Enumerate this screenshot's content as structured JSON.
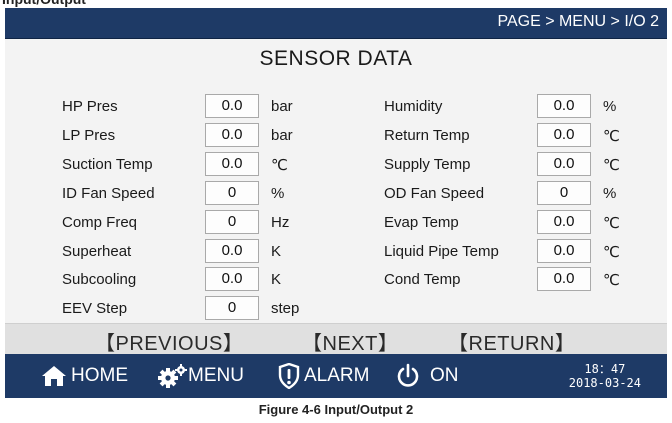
{
  "header": {
    "breadcrumb": "PAGE > MENU > I/O 2"
  },
  "title": "SENSOR DATA",
  "left_sensors": [
    {
      "label": "HP Pres",
      "value": "0.0",
      "unit": "bar"
    },
    {
      "label": "LP Pres",
      "value": "0.0",
      "unit": "bar"
    },
    {
      "label": "Suction Temp",
      "value": "0.0",
      "unit": "℃"
    },
    {
      "label": "ID Fan Speed",
      "value": "0",
      "unit": "%"
    },
    {
      "label": "Comp Freq",
      "value": "0",
      "unit": "Hz"
    },
    {
      "label": "Superheat",
      "value": "0.0",
      "unit": "K"
    },
    {
      "label": "Subcooling",
      "value": "0.0",
      "unit": "K"
    },
    {
      "label": "EEV Step",
      "value": "0",
      "unit": "step"
    }
  ],
  "right_sensors": [
    {
      "label": "Humidity",
      "value": "0.0",
      "unit": "%"
    },
    {
      "label": "Return Temp",
      "value": "0.0",
      "unit": "℃"
    },
    {
      "label": "Supply Temp",
      "value": "0.0",
      "unit": "℃"
    },
    {
      "label": "OD Fan Speed",
      "value": "0",
      "unit": "%"
    },
    {
      "label": "Evap Temp",
      "value": "0.0",
      "unit": "℃"
    },
    {
      "label": "Liquid Pipe Temp",
      "value": "0.0",
      "unit": "℃"
    },
    {
      "label": "Cond Temp",
      "value": "0.0",
      "unit": "℃"
    }
  ],
  "nav": {
    "previous": "【PREVIOUS】",
    "next": "【NEXT】",
    "return": "【RETURN】"
  },
  "bottom": {
    "home": "HOME",
    "menu": "MENU",
    "alarm": "ALARM",
    "power": "ON",
    "time": "18：47",
    "date": "2018-03-24",
    "home_icon": "home-icon",
    "menu_icon": "gears-icon",
    "alarm_icon": "alarm-shield-icon",
    "power_icon": "power-icon"
  },
  "colors": {
    "bar_background": "#1e3a66",
    "panel_background": "#f3f3f3",
    "nav_background": "#e0e0e0"
  },
  "caption": "Figure 4-6 Input/Output 2"
}
